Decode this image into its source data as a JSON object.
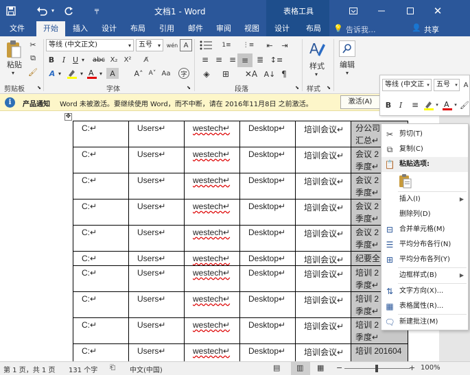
{
  "titlebar": {
    "title": "文档1 - Word",
    "context_tab_group": "表格工具",
    "save_icon": "save-icon",
    "undo_icon": "undo-icon",
    "redo_icon": "redo-icon",
    "customize_icon": "customize-qat-icon",
    "ribbon_display_icon": "ribbon-display-options-icon",
    "minimize_icon": "minimize-icon",
    "restore_icon": "restore-icon",
    "close_icon": "close-icon"
  },
  "tabs": {
    "file": "文件",
    "home": "开始",
    "insert": "插入",
    "design": "设计",
    "layout": "布局",
    "references": "引用",
    "mailings": "邮件",
    "review": "审阅",
    "view": "视图",
    "table_design": "设计",
    "table_layout": "布局",
    "tell_me": "告诉我...",
    "share": "共享"
  },
  "ribbon": {
    "paste": "粘贴",
    "clipboard": "剪贴板",
    "font_name": "等线 (中文正文)",
    "font_size": "五号",
    "font_group": "字体",
    "paragraph_group": "段落",
    "styles": "样式",
    "styles_group": "样式",
    "editing": "编辑",
    "bold": "B",
    "italic": "I",
    "underline": "U",
    "strikethrough": "abc",
    "subscript": "X₂",
    "superscript": "X²"
  },
  "notification": {
    "title": "产品通知",
    "message": "Word 未被激活。要继续使用 Word，而不中断，请在 2016年11月8日 之前激活。",
    "button": "激活(A)"
  },
  "table": {
    "rows": [
      [
        "C:↵",
        "Users↵",
        "westech↵",
        "Desktop↵",
        "培训会议↵",
        "分公司",
        "汇总↵"
      ],
      [
        "C:↵",
        "Users↵",
        "westech↵",
        "Desktop↵",
        "培训会议↵",
        "会议 2",
        "季度↵"
      ],
      [
        "C:↵",
        "Users↵",
        "westech↵",
        "Desktop↵",
        "培训会议↵",
        "会议 2",
        "季度↵"
      ],
      [
        "C:↵",
        "Users↵",
        "westech↵",
        "Desktop↵",
        "培训会议↵",
        "会议 2",
        "季度↵"
      ],
      [
        "C:↵",
        "Users↵",
        "westech↵",
        "Desktop↵",
        "培训会议↵",
        "会议 2",
        "季度↵"
      ],
      [
        "C:↵",
        "Users↵",
        "westech↵",
        "Desktop↵",
        "培训会议↵",
        "纪要全",
        ""
      ],
      [
        "C:↵",
        "Users↵",
        "westech↵",
        "Desktop↵",
        "培训会议↵",
        "培训 2",
        "季度↵"
      ],
      [
        "C:↵",
        "Users↵",
        "westech↵",
        "Desktop↵",
        "培训会议↵",
        "培训 2",
        "季度↵"
      ],
      [
        "C:↵",
        "Users↵",
        "westech↵",
        "Desktop↵",
        "培训会议↵",
        "培训 2",
        "季度↵"
      ],
      [
        "C:↵",
        "Users↵",
        "westech↵",
        "Desktop↵",
        "培训会议↵",
        "培训 201604",
        ""
      ]
    ]
  },
  "minitoolbar": {
    "font_name": "等线 (中文正",
    "font_size": "五号",
    "bold": "B",
    "italic": "I"
  },
  "context_menu": {
    "cut": "剪切(T)",
    "copy": "复制(C)",
    "paste_options": "粘贴选项:",
    "insert": "插入(I)",
    "delete_column": "删除列(D)",
    "merge_cells": "合并单元格(M)",
    "distribute_rows": "平均分布各行(N)",
    "distribute_columns": "平均分布各列(Y)",
    "border_styles": "边框样式(B)",
    "text_direction": "文字方向(X)...",
    "table_properties": "表格属性(R)...",
    "new_comment": "新建批注(M)"
  },
  "statusbar": {
    "page": "第 1 页，共 1 页",
    "words": "131 个字",
    "language": "中文(中国)",
    "zoom": "100%"
  }
}
